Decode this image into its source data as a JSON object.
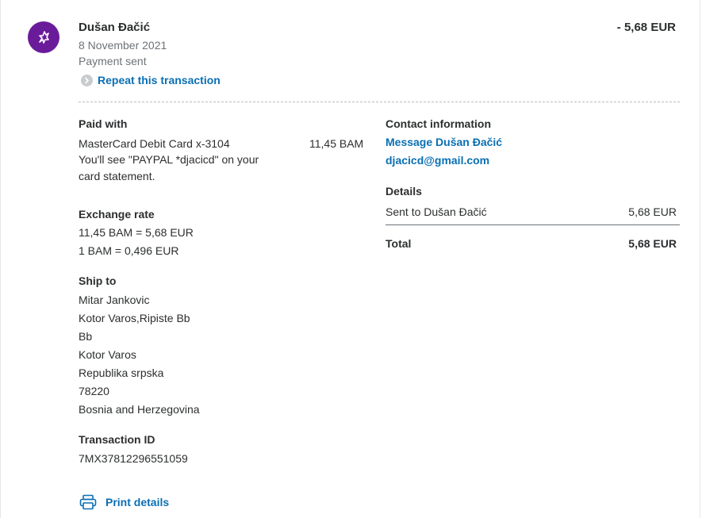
{
  "header": {
    "name": "Dušan Đačić",
    "date": "8 November 2021",
    "status": "Payment sent",
    "amount": "- 5,68 EUR",
    "repeat_label": "Repeat this transaction",
    "avatar_icon": "bird-logo-icon"
  },
  "paid_with": {
    "heading": "Paid with",
    "card": "MasterCard Debit Card x-3104",
    "amount": "11,45 BAM",
    "note_line1": "You'll see \"PAYPAL *djacicd\" on your",
    "note_line2": "card statement."
  },
  "exchange": {
    "heading": "Exchange rate",
    "line1": "11,45 BAM = 5,68 EUR",
    "line2": "1 BAM = 0,496 EUR"
  },
  "ship_to": {
    "heading": "Ship to",
    "lines": [
      "Mitar Jankovic",
      "Kotor Varos,Ripiste Bb",
      "Bb",
      "Kotor Varos",
      "Republika srpska",
      "78220",
      "Bosnia and Herzegovina"
    ]
  },
  "transaction": {
    "heading": "Transaction ID",
    "id": "7MX37812296551059"
  },
  "contact": {
    "heading": "Contact information",
    "message_link": "Message Dušan Đačić",
    "email": "djacicd@gmail.com"
  },
  "details": {
    "heading": "Details",
    "sent_label": "Sent to Dušan Đačić",
    "sent_amount": "5,68 EUR",
    "total_label": "Total",
    "total_amount": "5,68 EUR"
  },
  "footer": {
    "print_label": "Print details",
    "print_icon": "printer-icon"
  },
  "colors": {
    "link": "#0a6fb3",
    "avatar": "#6a1b9a",
    "muted": "#6c7378"
  }
}
